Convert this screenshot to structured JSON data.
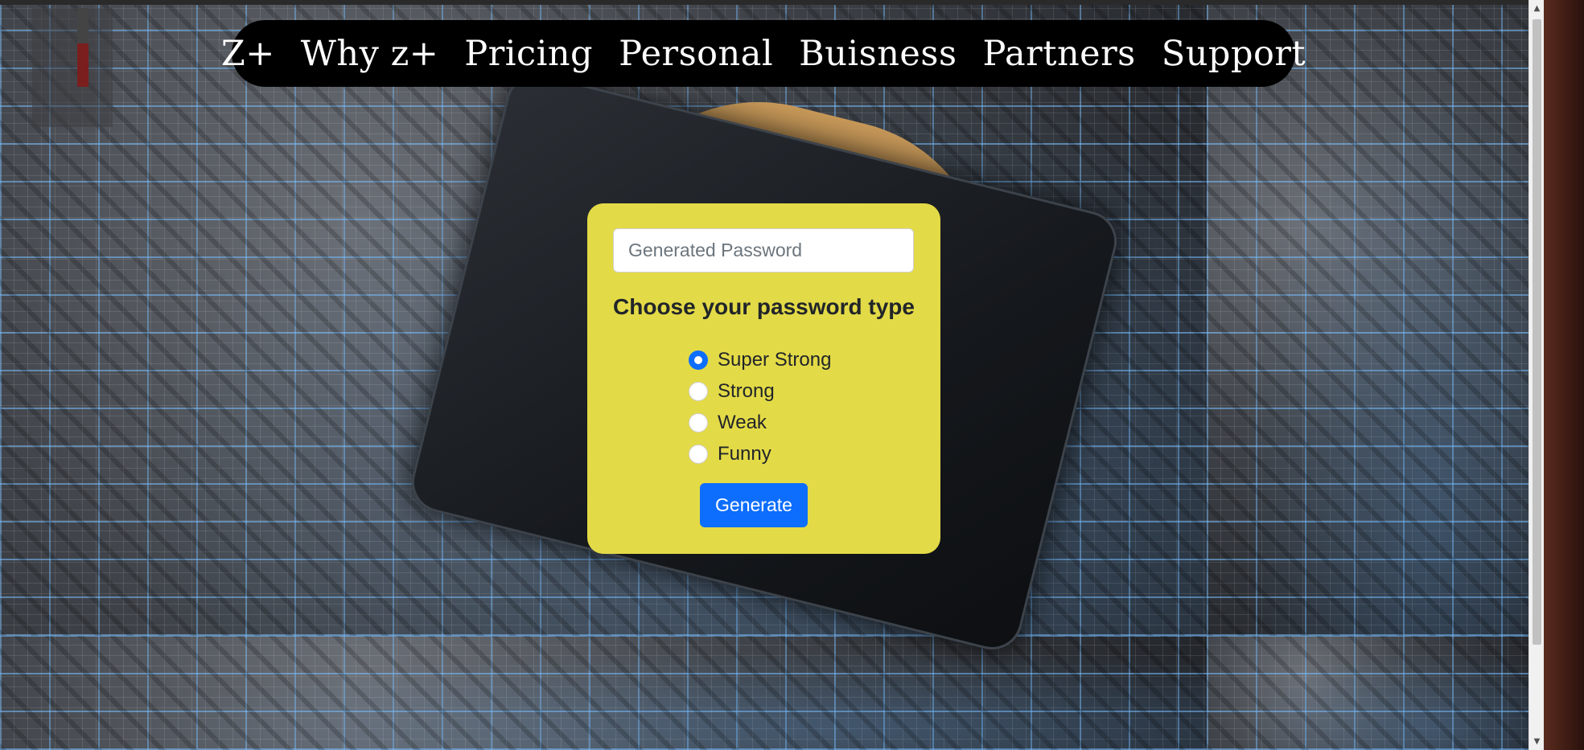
{
  "nav": {
    "items": [
      "Z+",
      "Why z+",
      "Pricing",
      "Personal",
      "Buisness",
      "Partners",
      "Support"
    ]
  },
  "generator": {
    "password_placeholder": "Generated Password",
    "password_value": "",
    "heading": "Choose your password type",
    "options": [
      {
        "label": "Super Strong",
        "checked": true
      },
      {
        "label": "Strong",
        "checked": false
      },
      {
        "label": "Weak",
        "checked": false
      },
      {
        "label": "Funny",
        "checked": false
      }
    ],
    "button_label": "Generate"
  },
  "colors": {
    "card_background": "#e3da47",
    "navbar_background": "#000000",
    "accent": "#0d6efd"
  },
  "icons": {
    "scroll_up": "triangle-up-icon",
    "scroll_down": "triangle-down-icon"
  }
}
